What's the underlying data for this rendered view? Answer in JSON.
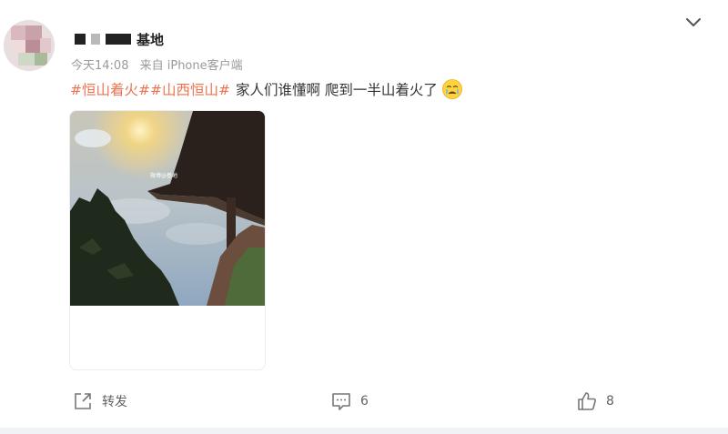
{
  "post": {
    "username_visible": "基地",
    "timestamp": "今天14:08",
    "source": "来自 iPhone客户端",
    "hashtags": [
      "#恒山着火#",
      "#山西恒山#"
    ],
    "text": "家人们谁懂啊 爬到一半山着火了",
    "emoji": "crying-face-emoji",
    "image_watermark": "微博@基地"
  },
  "actions": {
    "repost_label": "转发",
    "comment_count": "6",
    "like_count": "8"
  },
  "colors": {
    "hashtag": "#eb7350",
    "meta_text": "#9a9a9a",
    "body_text": "#333333"
  }
}
